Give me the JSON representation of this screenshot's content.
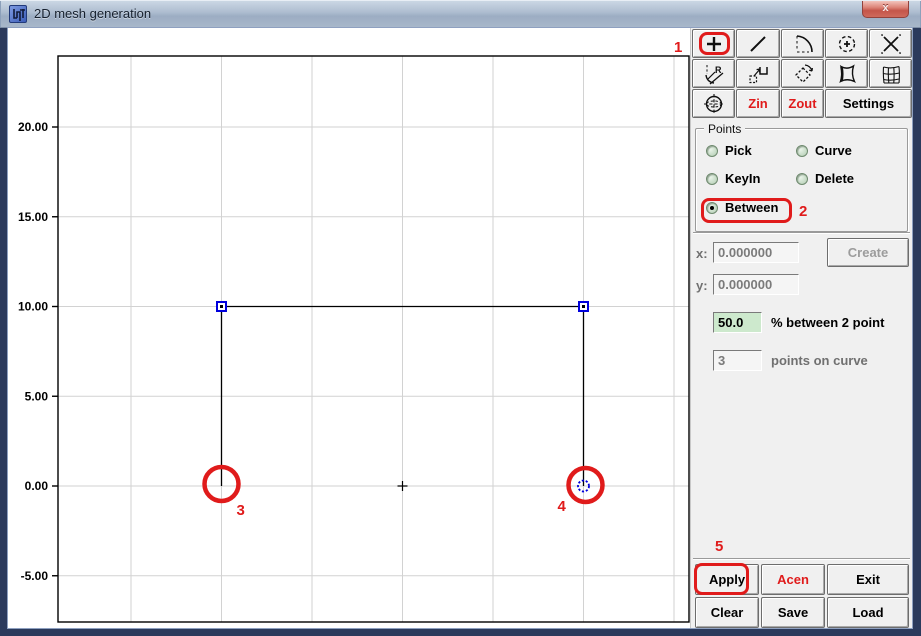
{
  "window": {
    "title": "2D mesh generation",
    "close_label": "x"
  },
  "toolbar": {
    "row1": [
      {
        "icon": "crosshair-plus",
        "highlighted": true
      },
      {
        "icon": "line-segment"
      },
      {
        "icon": "arc-dashed"
      },
      {
        "icon": "circle-center-plus"
      },
      {
        "icon": "intersection-x"
      }
    ],
    "row2": [
      {
        "icon": "fillet-radius"
      },
      {
        "icon": "copy-translate"
      },
      {
        "icon": "rotate-diamond"
      },
      {
        "icon": "region-boundary"
      },
      {
        "icon": "mesh-grid"
      }
    ],
    "row3": [
      {
        "icon": "zoom-extents"
      }
    ],
    "zin_label": "Zin",
    "zout_label": "Zout",
    "settings_label": "Settings"
  },
  "points": {
    "legend": "Points",
    "radios": [
      {
        "label": "Pick",
        "selected": false
      },
      {
        "label": "Curve",
        "selected": false
      },
      {
        "label": "KeyIn",
        "selected": false
      },
      {
        "label": "Delete",
        "selected": false
      },
      {
        "label": "Between",
        "selected": true
      }
    ]
  },
  "inputs": {
    "x_label": "x:",
    "x_value": "0.000000",
    "y_label": "y:",
    "y_value": "0.000000",
    "create_label": "Create",
    "percent_value": "50.0",
    "percent_label": "% between 2 point",
    "curve_value": "3",
    "curve_label": "points on curve"
  },
  "actions": {
    "apply": "Apply",
    "acen": "Acen",
    "exit": "Exit",
    "clear": "Clear",
    "save": "Save",
    "load": "Load"
  },
  "annotations": {
    "n1": "1",
    "n2": "2",
    "n3": "3",
    "n4": "4",
    "n5": "5"
  },
  "canvas": {
    "y_tick_labels": [
      "20.00",
      "15.00",
      "10.00",
      "5.00",
      "0.00",
      "-5.00"
    ],
    "y_tick_values": [
      20,
      15,
      10,
      5,
      0,
      -5
    ],
    "x_grid_values": [
      -15,
      -10,
      -5,
      0,
      5,
      10,
      15
    ],
    "shape_lines": [
      [
        -10,
        10,
        10,
        10
      ],
      [
        -10,
        10,
        -10,
        0
      ],
      [
        10,
        10,
        10,
        0
      ]
    ],
    "square_markers": [
      [
        -10,
        10
      ],
      [
        10,
        10
      ]
    ],
    "dashed_circle_marker": [
      10,
      0
    ],
    "origin_cross": [
      0,
      0
    ],
    "red_circle_annotations": [
      {
        "label": "3",
        "at": [
          -10,
          0
        ]
      },
      {
        "label": "4",
        "at": [
          10,
          0
        ]
      }
    ],
    "corner_annotation": "1"
  },
  "colors": {
    "annotation_red": "#e01b1b",
    "marker_blue": "#0000dd",
    "grid_gray": "#d2d2d2",
    "percent_field_green": "#cde9cd",
    "frame_navy": "#2b3a5c"
  }
}
